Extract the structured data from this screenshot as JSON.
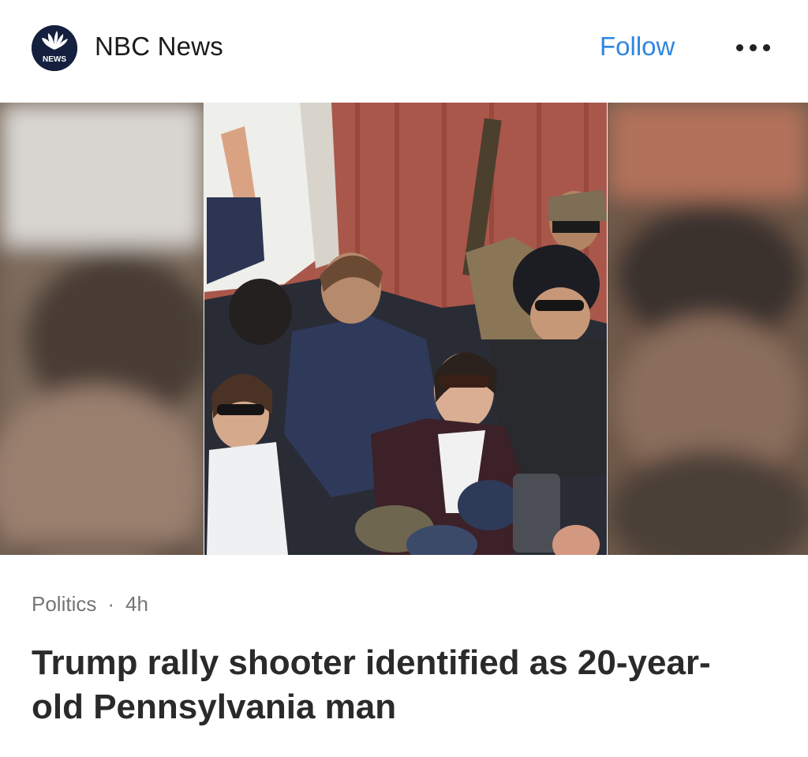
{
  "header": {
    "logo_text": "NEWS",
    "logo_icon": "nbc-peacock-icon",
    "source_name": "NBC News",
    "follow_label": "Follow",
    "more_icon": "ellipsis-icon"
  },
  "hero": {
    "image_icon": "photo-image"
  },
  "meta": {
    "category": "Politics",
    "separator": "·",
    "time_ago": "4h"
  },
  "headline": "Trump rally shooter identified as 20-year-old Pennsylvania man",
  "colors": {
    "accent": "#2f86e0",
    "logo_bg": "#14203d",
    "meta_text": "#757575",
    "headline_text": "#2a2a2a"
  }
}
